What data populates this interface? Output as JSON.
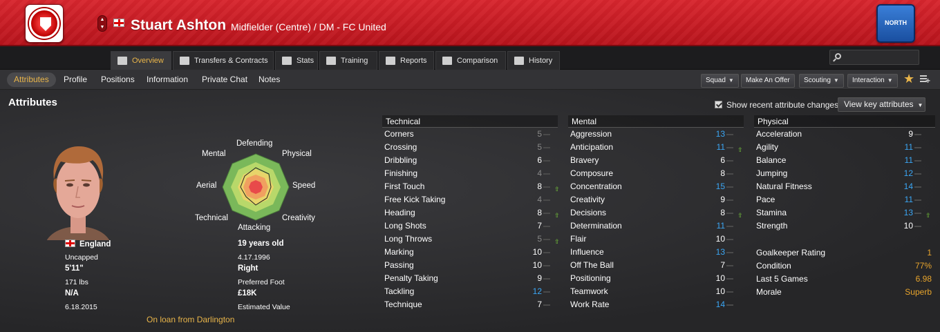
{
  "header": {
    "player_name": "Stuart Ashton",
    "subtitle": "Midfielder (Centre) / DM - FC United",
    "league_badge_text": "NORTH",
    "accent": "#c8171f"
  },
  "tabs": [
    {
      "label": "Overview",
      "icon": "overview-icon",
      "active": true
    },
    {
      "label": "Transfers & Contracts",
      "icon": "contract-icon"
    },
    {
      "label": "Stats",
      "icon": "stats-icon"
    },
    {
      "label": "Training",
      "icon": "training-icon"
    },
    {
      "label": "Reports",
      "icon": "reports-icon"
    },
    {
      "label": "Comparison",
      "icon": "comparison-icon"
    },
    {
      "label": "History",
      "icon": "history-icon"
    }
  ],
  "subnav": {
    "items": [
      "Attributes",
      "Profile",
      "Positions",
      "Information",
      "Private Chat",
      "Notes"
    ],
    "active": "Attributes",
    "buttons": [
      "Squad",
      "Make An Offer",
      "Scouting",
      "Interaction"
    ]
  },
  "section": {
    "title": "Attributes",
    "show_changes_label": "Show recent attribute changes",
    "show_changes_checked": true,
    "view_key_label": "View key attributes"
  },
  "profile": {
    "nationality": "England",
    "caps": "Uncapped",
    "height": "5'11\"",
    "weight": "171 lbs",
    "unknown": "N/A",
    "date": "6.18.2015",
    "age": "19 years old",
    "dob": "4.17.1996",
    "foot": "Right",
    "foot_label": "Preferred Foot",
    "value": "£18K",
    "value_label": "Estimated Value",
    "loan": "On loan from Darlington"
  },
  "radar": {
    "labels": {
      "defending": "Defending",
      "physical": "Physical",
      "speed": "Speed",
      "creativity": "Creativity",
      "attacking": "Attacking",
      "technical": "Technical",
      "aerial": "Aerial",
      "mental": "Mental"
    }
  },
  "technical": {
    "title": "Technical",
    "rows": [
      {
        "name": "Corners",
        "value": "5",
        "color": "grey"
      },
      {
        "name": "Crossing",
        "value": "5",
        "color": "grey"
      },
      {
        "name": "Dribbling",
        "value": "6",
        "color": "white"
      },
      {
        "name": "Finishing",
        "value": "4",
        "color": "grey"
      },
      {
        "name": "First Touch",
        "value": "8",
        "color": "white",
        "up": true
      },
      {
        "name": "Free Kick Taking",
        "value": "4",
        "color": "grey"
      },
      {
        "name": "Heading",
        "value": "8",
        "color": "white",
        "up": true
      },
      {
        "name": "Long Shots",
        "value": "7",
        "color": "white"
      },
      {
        "name": "Long Throws",
        "value": "5",
        "color": "grey",
        "up": true
      },
      {
        "name": "Marking",
        "value": "10",
        "color": "white"
      },
      {
        "name": "Passing",
        "value": "10",
        "color": "white"
      },
      {
        "name": "Penalty Taking",
        "value": "9",
        "color": "white"
      },
      {
        "name": "Tackling",
        "value": "12",
        "color": "blue"
      },
      {
        "name": "Technique",
        "value": "7",
        "color": "white"
      }
    ]
  },
  "mental": {
    "title": "Mental",
    "rows": [
      {
        "name": "Aggression",
        "value": "13",
        "color": "blue"
      },
      {
        "name": "Anticipation",
        "value": "11",
        "color": "blue",
        "up": true
      },
      {
        "name": "Bravery",
        "value": "6",
        "color": "white"
      },
      {
        "name": "Composure",
        "value": "8",
        "color": "white"
      },
      {
        "name": "Concentration",
        "value": "15",
        "color": "blue"
      },
      {
        "name": "Creativity",
        "value": "9",
        "color": "white"
      },
      {
        "name": "Decisions",
        "value": "8",
        "color": "white",
        "up": true
      },
      {
        "name": "Determination",
        "value": "11",
        "color": "blue"
      },
      {
        "name": "Flair",
        "value": "10",
        "color": "white"
      },
      {
        "name": "Influence",
        "value": "13",
        "color": "blue"
      },
      {
        "name": "Off The Ball",
        "value": "7",
        "color": "white"
      },
      {
        "name": "Positioning",
        "value": "10",
        "color": "white"
      },
      {
        "name": "Teamwork",
        "value": "10",
        "color": "white"
      },
      {
        "name": "Work Rate",
        "value": "14",
        "color": "blue"
      }
    ]
  },
  "physical": {
    "title": "Physical",
    "rows": [
      {
        "name": "Acceleration",
        "value": "9",
        "color": "white"
      },
      {
        "name": "Agility",
        "value": "11",
        "color": "blue"
      },
      {
        "name": "Balance",
        "value": "11",
        "color": "blue"
      },
      {
        "name": "Jumping",
        "value": "12",
        "color": "blue"
      },
      {
        "name": "Natural Fitness",
        "value": "14",
        "color": "blue"
      },
      {
        "name": "Pace",
        "value": "11",
        "color": "blue"
      },
      {
        "name": "Stamina",
        "value": "13",
        "color": "blue",
        "up": true
      },
      {
        "name": "Strength",
        "value": "10",
        "color": "white"
      }
    ],
    "extra": [
      {
        "name": "Goalkeeper Rating",
        "value": "1",
        "color": "orange"
      },
      {
        "name": "Condition",
        "value": "77%",
        "color": "orange"
      },
      {
        "name": "Last 5 Games",
        "value": "6.98",
        "color": "orange"
      },
      {
        "name": "Morale",
        "value": "Superb",
        "color": "orange"
      }
    ]
  }
}
